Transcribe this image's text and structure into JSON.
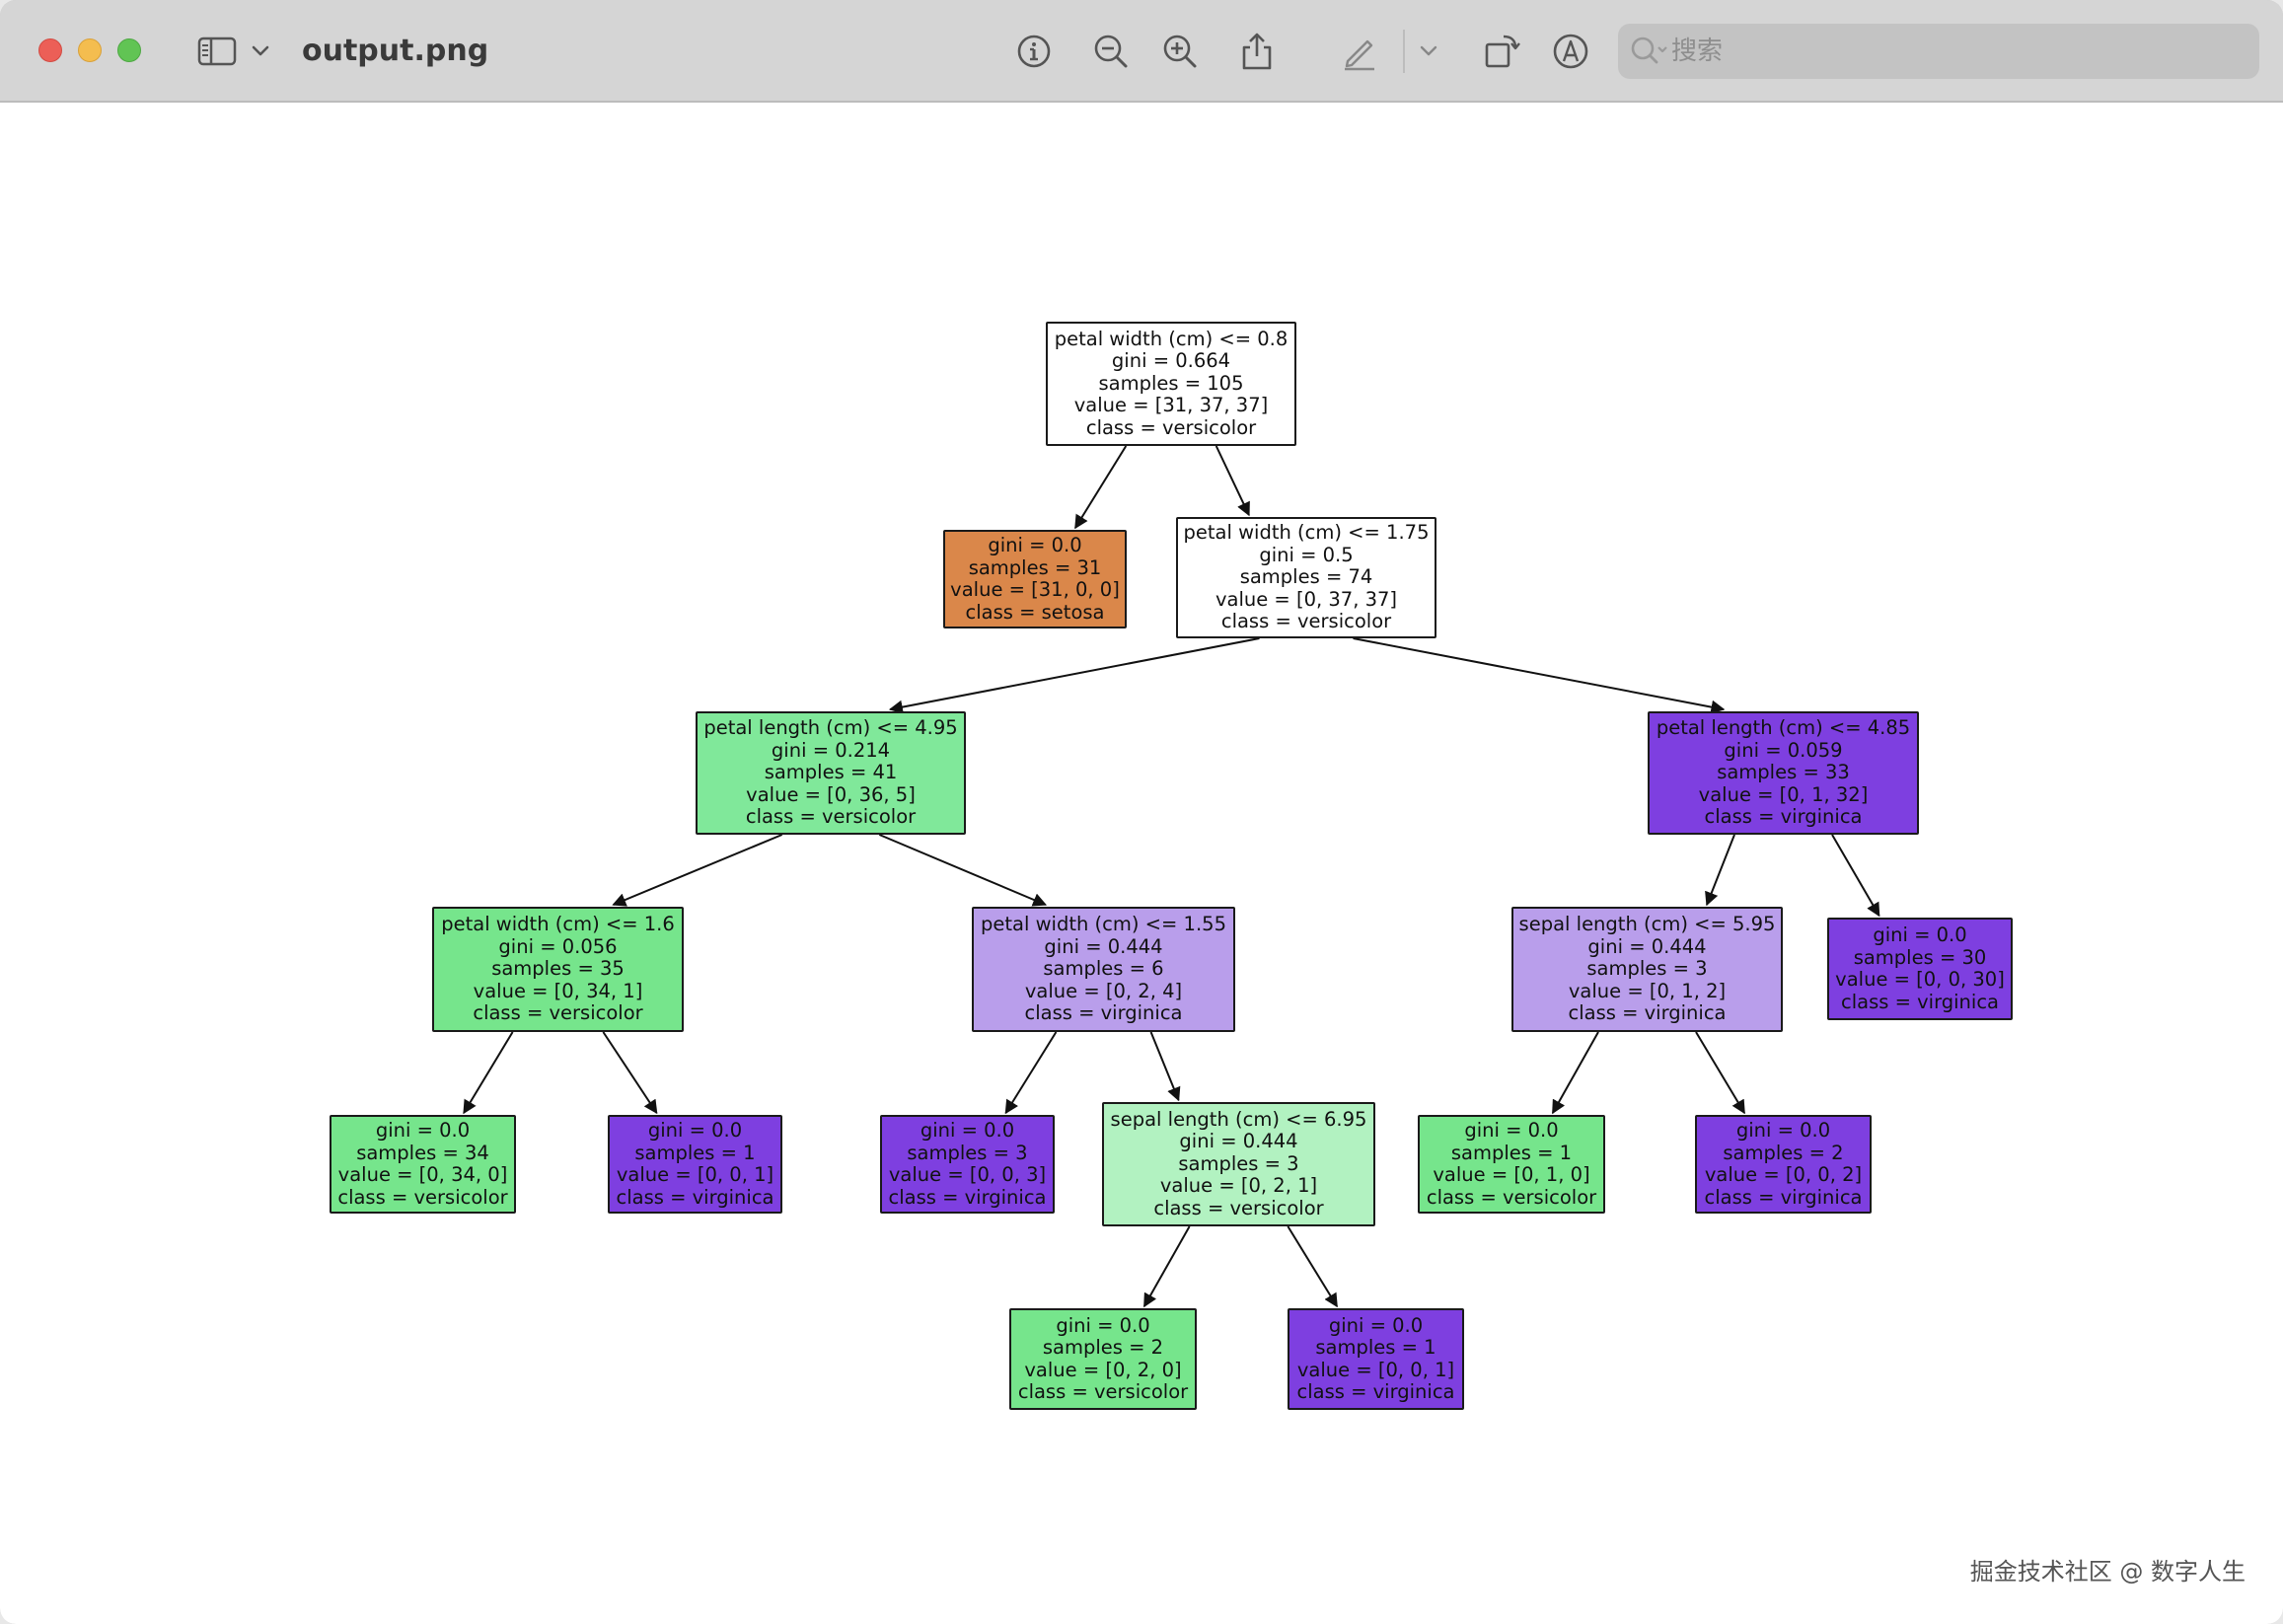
{
  "window": {
    "title": "output.png",
    "search_placeholder": "搜索"
  },
  "toolbar": {
    "icons": [
      "sidebar-icon",
      "chevron-down-icon",
      "info-icon",
      "zoom-out-icon",
      "zoom-in-icon",
      "share-icon",
      "markup-pen-icon",
      "chevron-down-icon",
      "rotate-icon",
      "annotate-icon",
      "search-icon"
    ]
  },
  "colors": {
    "setosa": "#e58139",
    "versicolor_strong": "#7ae68f",
    "versicolor_pure": "#39e581",
    "virginica_strong": "#8139e5",
    "virginica_light": "#b797ec",
    "neutral": "#ffffff"
  },
  "tree": {
    "nodes": [
      {
        "id": "n0",
        "lines": [
          "petal width (cm) <= 0.8",
          "gini = 0.664",
          "samples = 105",
          "value = [31, 37, 37]",
          "class = versicolor"
        ],
        "fill": "#ffffff"
      },
      {
        "id": "n1",
        "lines": [
          "gini = 0.0",
          "samples = 31",
          "value = [31, 0, 0]",
          "class = setosa"
        ],
        "fill": "#da874a"
      },
      {
        "id": "n2",
        "lines": [
          "petal width (cm) <= 1.75",
          "gini = 0.5",
          "samples = 74",
          "value = [0, 37, 37]",
          "class = versicolor"
        ],
        "fill": "#ffffff"
      },
      {
        "id": "n3",
        "lines": [
          "petal length (cm) <= 4.95",
          "gini = 0.214",
          "samples = 41",
          "value = [0, 36, 5]",
          "class = versicolor"
        ],
        "fill": "#80e89a"
      },
      {
        "id": "n4",
        "lines": [
          "petal length (cm) <= 4.85",
          "gini = 0.059",
          "samples = 33",
          "value = [0, 1, 32]",
          "class = virginica"
        ],
        "fill": "#7e3fe0"
      },
      {
        "id": "n5",
        "lines": [
          "petal width (cm) <= 1.6",
          "gini = 0.056",
          "samples = 35",
          "value = [0, 34, 1]",
          "class = versicolor"
        ],
        "fill": "#76e58c"
      },
      {
        "id": "n6",
        "lines": [
          "petal width (cm) <= 1.55",
          "gini = 0.444",
          "samples = 6",
          "value = [0, 2, 4]",
          "class = virginica"
        ],
        "fill": "#b99eeb"
      },
      {
        "id": "n7",
        "lines": [
          "sepal length (cm) <= 5.95",
          "gini = 0.444",
          "samples = 3",
          "value = [0, 1, 2]",
          "class = virginica"
        ],
        "fill": "#b99eeb"
      },
      {
        "id": "n8",
        "lines": [
          "gini = 0.0",
          "samples = 30",
          "value = [0, 0, 30]",
          "class = virginica"
        ],
        "fill": "#7e3fe0"
      },
      {
        "id": "n9",
        "lines": [
          "gini = 0.0",
          "samples = 34",
          "value = [0, 34, 0]",
          "class = versicolor"
        ],
        "fill": "#76e58c"
      },
      {
        "id": "n10",
        "lines": [
          "gini = 0.0",
          "samples = 1",
          "value = [0, 0, 1]",
          "class = virginica"
        ],
        "fill": "#7e3fe0"
      },
      {
        "id": "n11",
        "lines": [
          "gini = 0.0",
          "samples = 3",
          "value = [0, 0, 3]",
          "class = virginica"
        ],
        "fill": "#7e3fe0"
      },
      {
        "id": "n12",
        "lines": [
          "sepal length (cm) <= 6.95",
          "gini = 0.444",
          "samples = 3",
          "value = [0, 2, 1]",
          "class = versicolor"
        ],
        "fill": "#b2f2c1"
      },
      {
        "id": "n13",
        "lines": [
          "gini = 0.0",
          "samples = 1",
          "value = [0, 1, 0]",
          "class = versicolor"
        ],
        "fill": "#76e58c"
      },
      {
        "id": "n14",
        "lines": [
          "gini = 0.0",
          "samples = 2",
          "value = [0, 0, 2]",
          "class = virginica"
        ],
        "fill": "#7e3fe0"
      },
      {
        "id": "n15",
        "lines": [
          "gini = 0.0",
          "samples = 2",
          "value = [0, 2, 0]",
          "class = versicolor"
        ],
        "fill": "#76e58c"
      },
      {
        "id": "n16",
        "lines": [
          "gini = 0.0",
          "samples = 1",
          "value = [0, 0, 1]",
          "class = virginica"
        ],
        "fill": "#7e3fe0"
      }
    ],
    "edges": [
      [
        "n0",
        "n1"
      ],
      [
        "n0",
        "n2"
      ],
      [
        "n2",
        "n3"
      ],
      [
        "n2",
        "n4"
      ],
      [
        "n3",
        "n5"
      ],
      [
        "n3",
        "n6"
      ],
      [
        "n4",
        "n7"
      ],
      [
        "n4",
        "n8"
      ],
      [
        "n5",
        "n9"
      ],
      [
        "n5",
        "n10"
      ],
      [
        "n6",
        "n11"
      ],
      [
        "n6",
        "n12"
      ],
      [
        "n7",
        "n13"
      ],
      [
        "n7",
        "n14"
      ],
      [
        "n12",
        "n15"
      ],
      [
        "n12",
        "n16"
      ]
    ]
  },
  "watermark": "掘金技术社区 @ 数字人生"
}
